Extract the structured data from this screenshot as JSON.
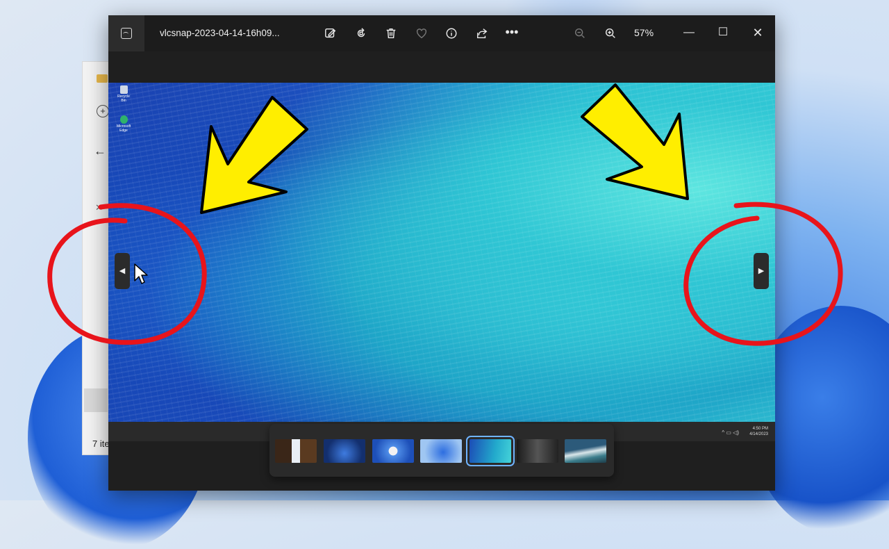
{
  "explorer": {
    "status_text": "7 ite"
  },
  "photos_window": {
    "file_title": "vlcsnap-2023-04-14-16h09...",
    "zoom_level": "57%",
    "toolbar_icons": [
      "edit-image-icon",
      "rotate-icon",
      "delete-icon",
      "favorite-heart-icon",
      "info-icon",
      "share-icon",
      "more-options-icon",
      "zoom-out-icon",
      "zoom-in-icon"
    ],
    "window_controls": [
      "minimize",
      "maximize",
      "close"
    ]
  },
  "image_content": {
    "desktop_icons": [
      "Recycle Bin",
      "Microsoft Edge"
    ],
    "clock_time": "4:50 PM",
    "clock_date": "4/14/2023"
  },
  "filmstrip": {
    "thumbnails": [
      "thumb-1",
      "thumb-2",
      "thumb-3",
      "thumb-4",
      "thumb-5",
      "thumb-6",
      "thumb-7"
    ],
    "active_index": 4
  },
  "annotations": {
    "arrow_color": "#ffee00",
    "circle_color": "#e8141b"
  }
}
